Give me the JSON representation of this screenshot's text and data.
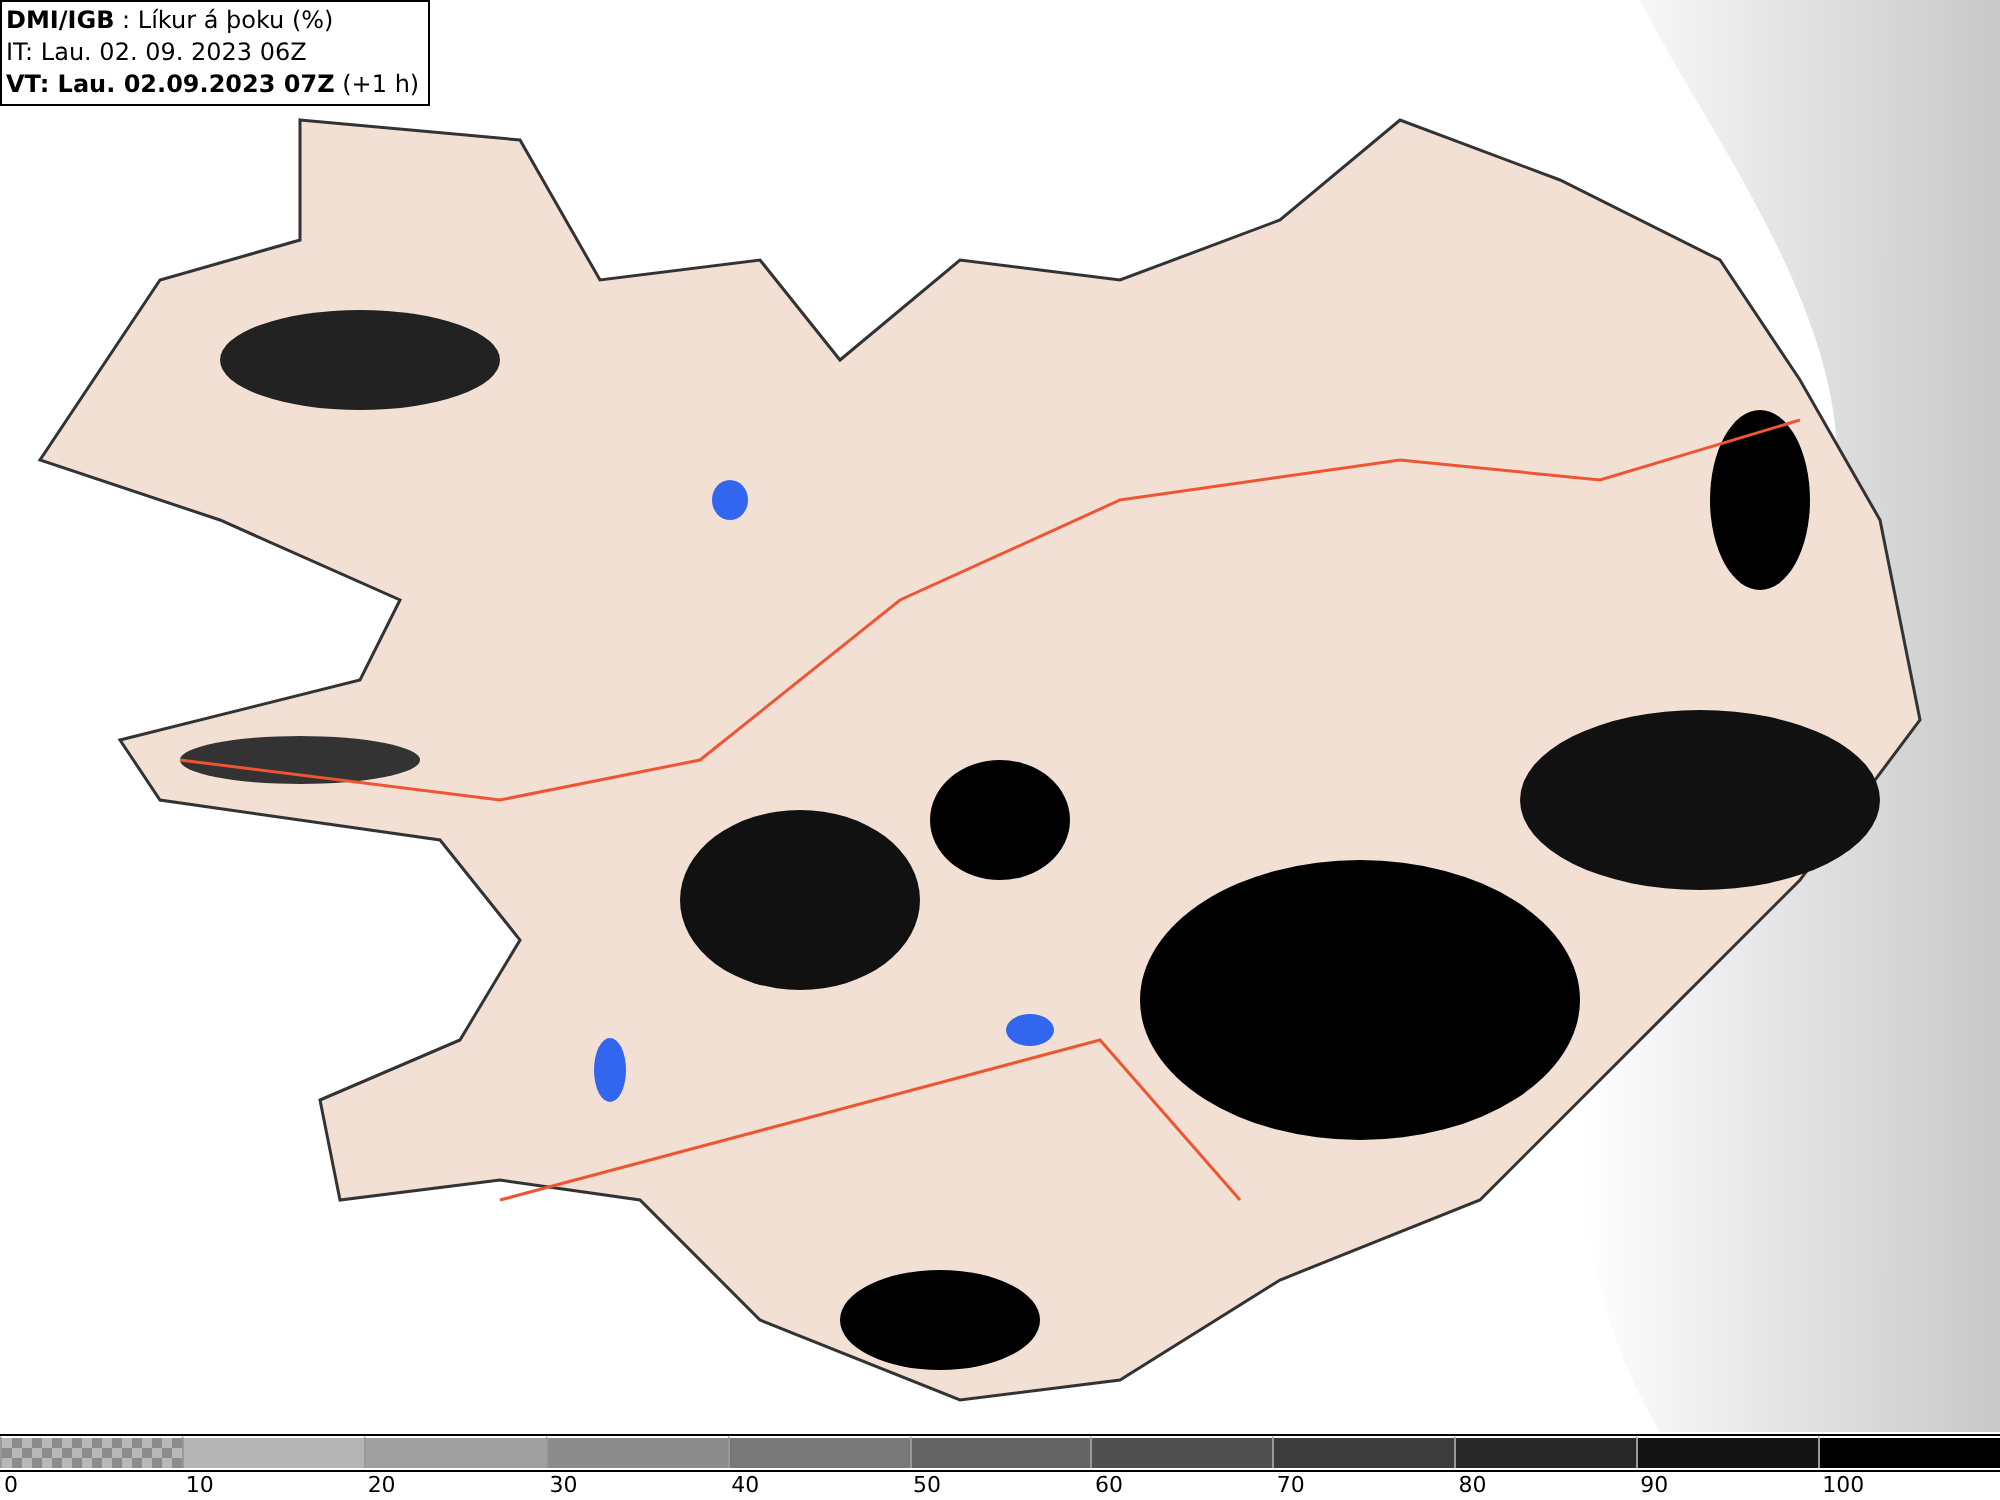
{
  "header": {
    "title": "**DMI/IGB** : Líkur á þoku (%)",
    "init_time": "IT: Lau. 02. 09. 2023 06Z",
    "valid_time": "**VT: Lau. 02.09.2023 07Z** (+1 h)"
  },
  "legend": {
    "segments": [
      {
        "kind": "checker",
        "color": "#8c8c8c"
      },
      {
        "kind": "solid",
        "color": "#b4b4b4"
      },
      {
        "kind": "solid",
        "color": "#a0a0a0"
      },
      {
        "kind": "solid",
        "color": "#8c8c8c"
      },
      {
        "kind": "solid",
        "color": "#787878"
      },
      {
        "kind": "solid",
        "color": "#646464"
      },
      {
        "kind": "solid",
        "color": "#505050"
      },
      {
        "kind": "solid",
        "color": "#3c3c3c"
      },
      {
        "kind": "solid",
        "color": "#282828"
      },
      {
        "kind": "solid",
        "color": "#141414"
      },
      {
        "kind": "solid",
        "color": "#000000"
      }
    ],
    "ticks": [
      "0",
      "10",
      "20",
      "30",
      "40",
      "50",
      "60",
      "70",
      "80",
      "90",
      "100"
    ]
  }
}
